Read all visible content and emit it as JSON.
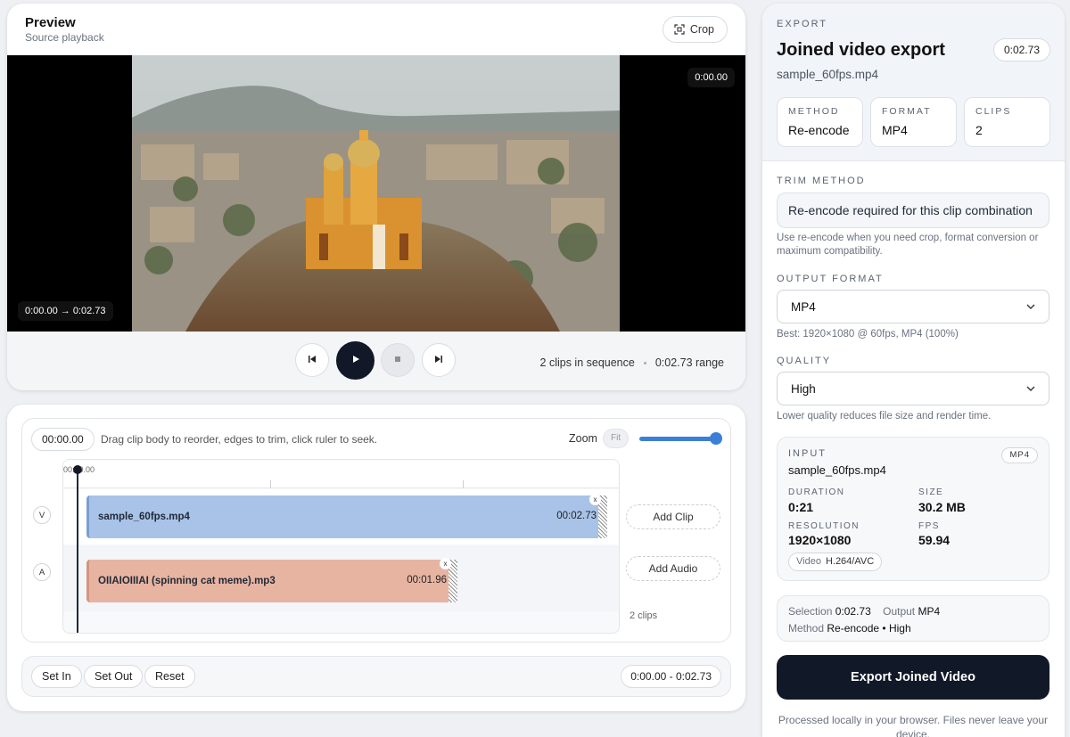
{
  "preview": {
    "title": "Preview",
    "subtitle": "Source playback",
    "crop_label": "Crop",
    "current_time": "0:00.00",
    "range_badge": "0:00.00 → 0:02.73",
    "clips_in_sequence": "2 clips in sequence",
    "range_text": "0:02.73 range",
    "controls": {
      "prev_icon": "skip-start-icon",
      "play_icon": "play-icon",
      "stop_icon": "stop-icon",
      "next_icon": "skip-end-icon"
    }
  },
  "timeline": {
    "time_field": "00:00.00",
    "hint": "Drag clip body to reorder, edges to trim, click ruler to seek.",
    "zoom_label": "Zoom",
    "fit_label": "Fit",
    "zoom_level": 1.0,
    "ruler_start": "00:00.00",
    "video_track_label": "V",
    "audio_track_label": "A",
    "video_clip": {
      "name": "sample_60fps.mp4",
      "duration": "00:02.73"
    },
    "audio_clip": {
      "name": "OIIAIOIIIAI (spinning cat meme).mp3",
      "duration": "00:01.96"
    },
    "remove_label": "x",
    "add_clip_label": "Add Clip",
    "add_audio_label": "Add Audio",
    "clips_count": "2 clips",
    "set_in_label": "Set In",
    "set_out_label": "Set Out",
    "reset_label": "Reset",
    "selection_range": "0:00.00 - 0:02.73"
  },
  "export": {
    "kicker": "EXPORT",
    "title": "Joined video export",
    "duration": "0:02.73",
    "filename": "sample_60fps.mp4",
    "stats": [
      {
        "label": "METHOD",
        "value": "Re-encode"
      },
      {
        "label": "FORMAT",
        "value": "MP4"
      },
      {
        "label": "CLIPS",
        "value": "2"
      }
    ],
    "trim_method_label": "TRIM METHOD",
    "trim_method_value": "Re-encode required for this clip combination",
    "trim_help": "Use re-encode when you need crop, format conversion or maximum compatibility.",
    "output_format_label": "OUTPUT FORMAT",
    "output_format_value": "MP4",
    "output_help": "Best: 1920×1080 @ 60fps, MP4 (100%)",
    "quality_label": "QUALITY",
    "quality_value": "High",
    "quality_help": "Lower quality reduces file size and render time.",
    "input": {
      "kicker": "INPUT",
      "badge": "MP4",
      "filename": "sample_60fps.mp4",
      "duration_label": "DURATION",
      "duration_value": "0:21",
      "size_label": "SIZE",
      "size_value": "30.2 MB",
      "resolution_label": "RESOLUTION",
      "resolution_value": "1920×1080",
      "fps_label": "FPS",
      "fps_value": "59.94",
      "codec_label": "Video",
      "codec_value": "H.264/AVC"
    },
    "summary": {
      "selection_label": "Selection",
      "selection_value": "0:02.73",
      "output_label": "Output",
      "output_value": "MP4",
      "method_label": "Method",
      "method_value": "Re-encode • High"
    },
    "export_button": "Export Joined Video",
    "footnote": "Processed locally in your browser. Files never leave your device."
  },
  "colors": {
    "accent": "#3b7fd9",
    "dark": "#111827",
    "video_clip": "#a9c3e8",
    "audio_clip": "#e8b4a2"
  }
}
